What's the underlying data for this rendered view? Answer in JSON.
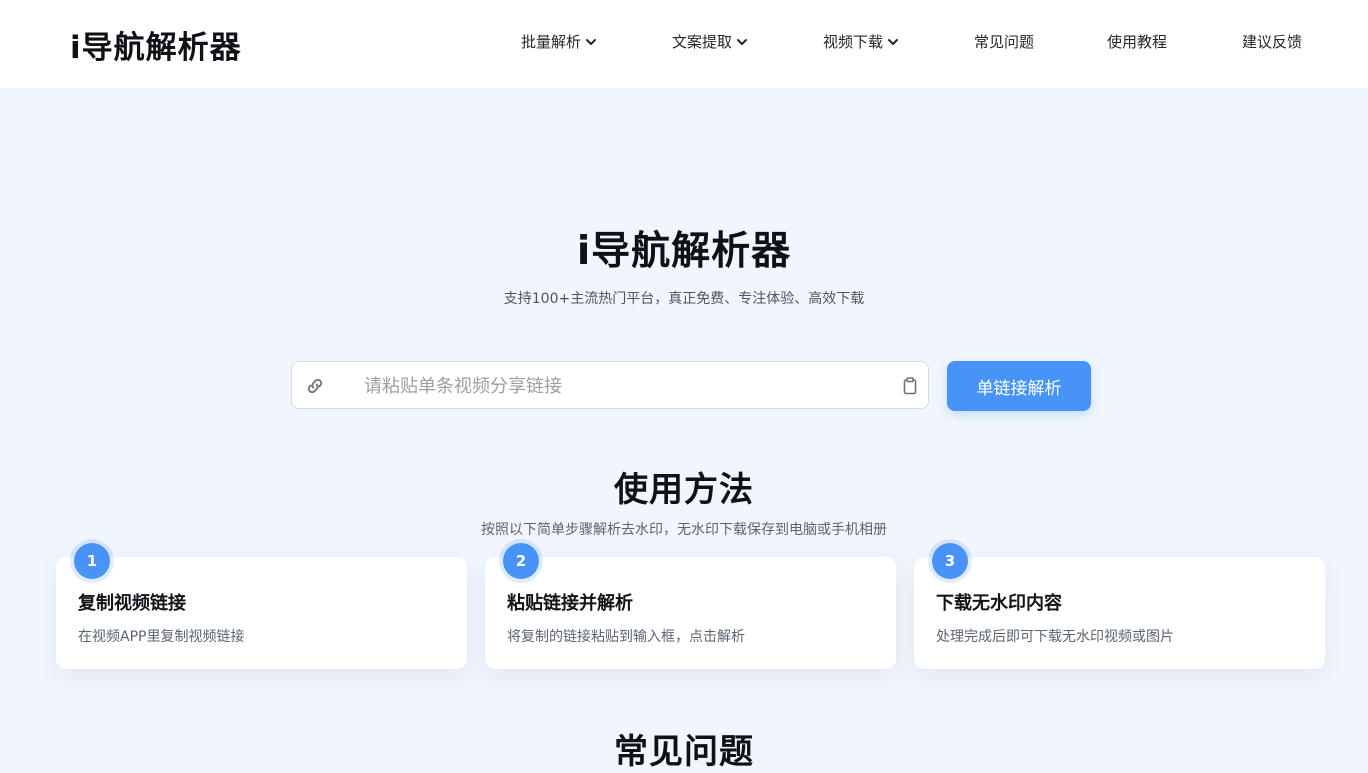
{
  "header": {
    "logo": "i导航解析器",
    "nav": [
      {
        "label": "批量解析",
        "dropdown": true
      },
      {
        "label": "文案提取",
        "dropdown": true
      },
      {
        "label": "视频下载",
        "dropdown": true
      },
      {
        "label": "常见问题",
        "dropdown": false
      },
      {
        "label": "使用教程",
        "dropdown": false
      },
      {
        "label": "建议反馈",
        "dropdown": false
      }
    ]
  },
  "hero": {
    "title": "i导航解析器",
    "subtitle": "支持100+主流热门平台，真正免费、专注体验、高效下载"
  },
  "search": {
    "placeholder": "请粘贴单条视频分享链接",
    "value": "",
    "button_label": "单链接解析",
    "icons": {
      "left": "link-icon",
      "right": "clipboard-icon"
    }
  },
  "usage": {
    "title": "使用方法",
    "subtitle": "按照以下简单步骤解析去水印，无水印下载保存到电脑或手机相册",
    "steps": [
      {
        "num": "1",
        "title": "复制视频链接",
        "desc": "在视频APP里复制视频链接"
      },
      {
        "num": "2",
        "title": "粘贴链接并解析",
        "desc": "将复制的链接粘贴到输入框，点击解析"
      },
      {
        "num": "3",
        "title": "下载无水印内容",
        "desc": "处理完成后即可下载无水印视频或图片"
      }
    ]
  },
  "faq": {
    "title": "常见问题"
  },
  "colors": {
    "accent": "#4793f8",
    "background": "#f1f6fd",
    "header_bg": "#ffffff"
  }
}
